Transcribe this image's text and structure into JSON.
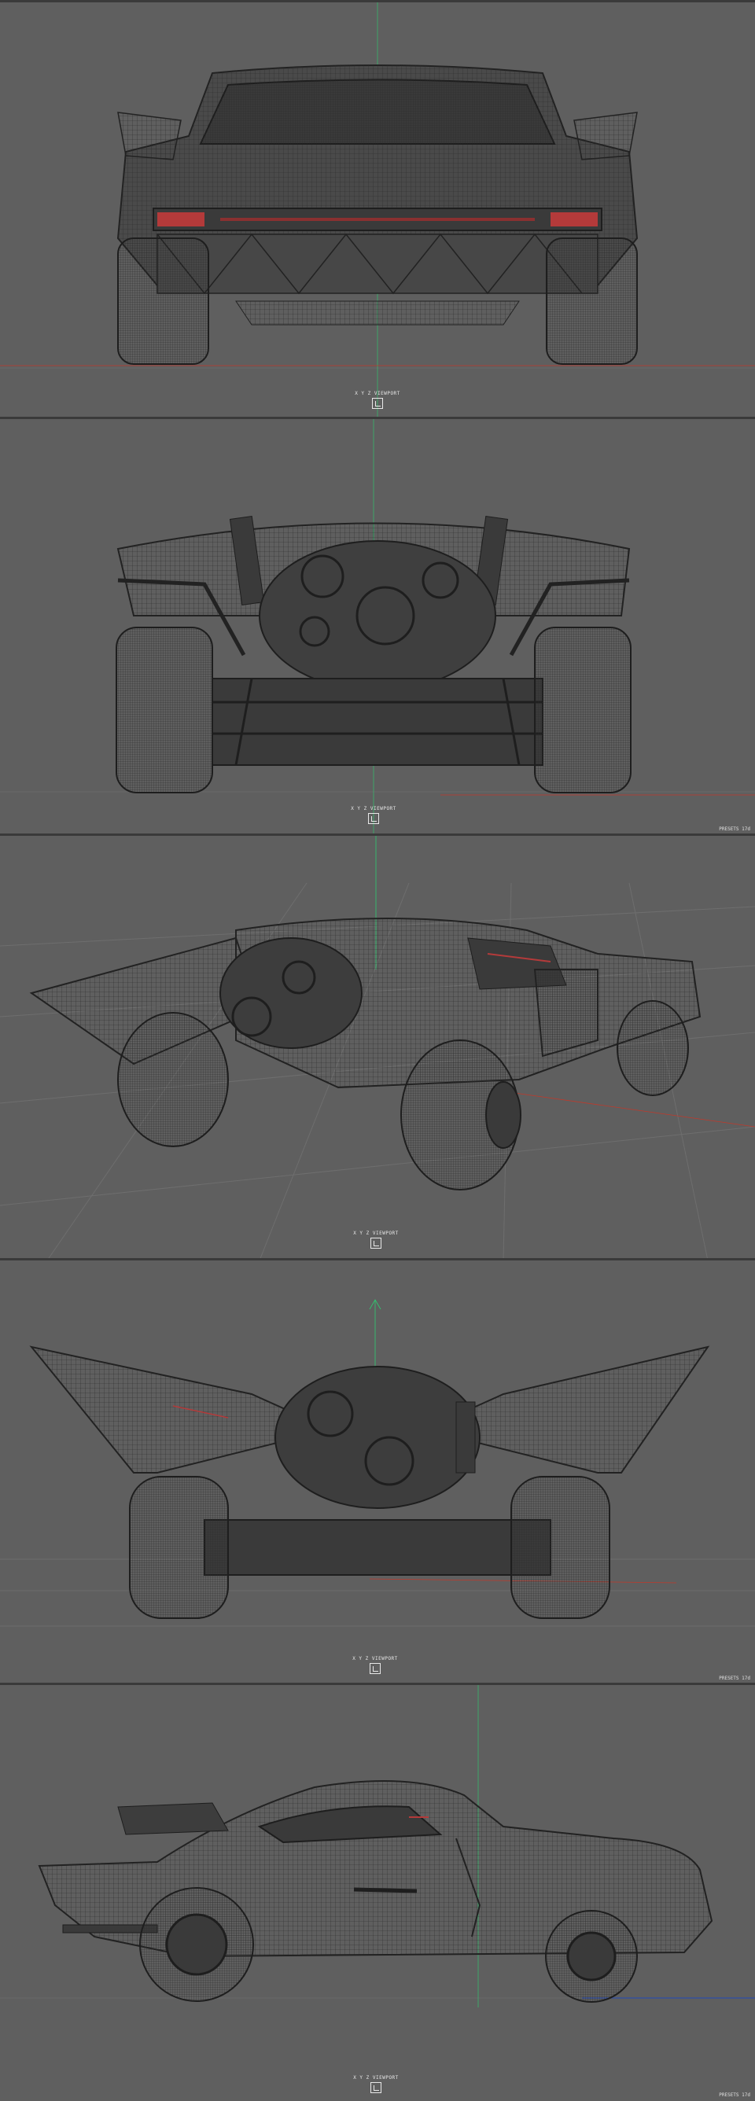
{
  "viewports": [
    {
      "id": "rear",
      "gizmo_label": "X Y Z  VIEWPORT",
      "stamp": ""
    },
    {
      "id": "front",
      "gizmo_label": "X Y Z  VIEWPORT",
      "stamp": "PRESETS 17d"
    },
    {
      "id": "perspective",
      "gizmo_label": "X Y Z  VIEWPORT",
      "stamp": ""
    },
    {
      "id": "front-low",
      "gizmo_label": "X Y Z  VIEWPORT",
      "stamp": "PRESETS 17d"
    },
    {
      "id": "side",
      "gizmo_label": "X Y Z  VIEWPORT",
      "stamp": "PRESETS 17d"
    }
  ],
  "colors": {
    "background": "#5f5f5f",
    "wire": "#2a2a2a",
    "grid": "#777777",
    "axis_red": "#c0392b",
    "axis_green": "#2ecc71",
    "axis_blue": "#2f4ea8",
    "taillight": "#b43a3a"
  }
}
